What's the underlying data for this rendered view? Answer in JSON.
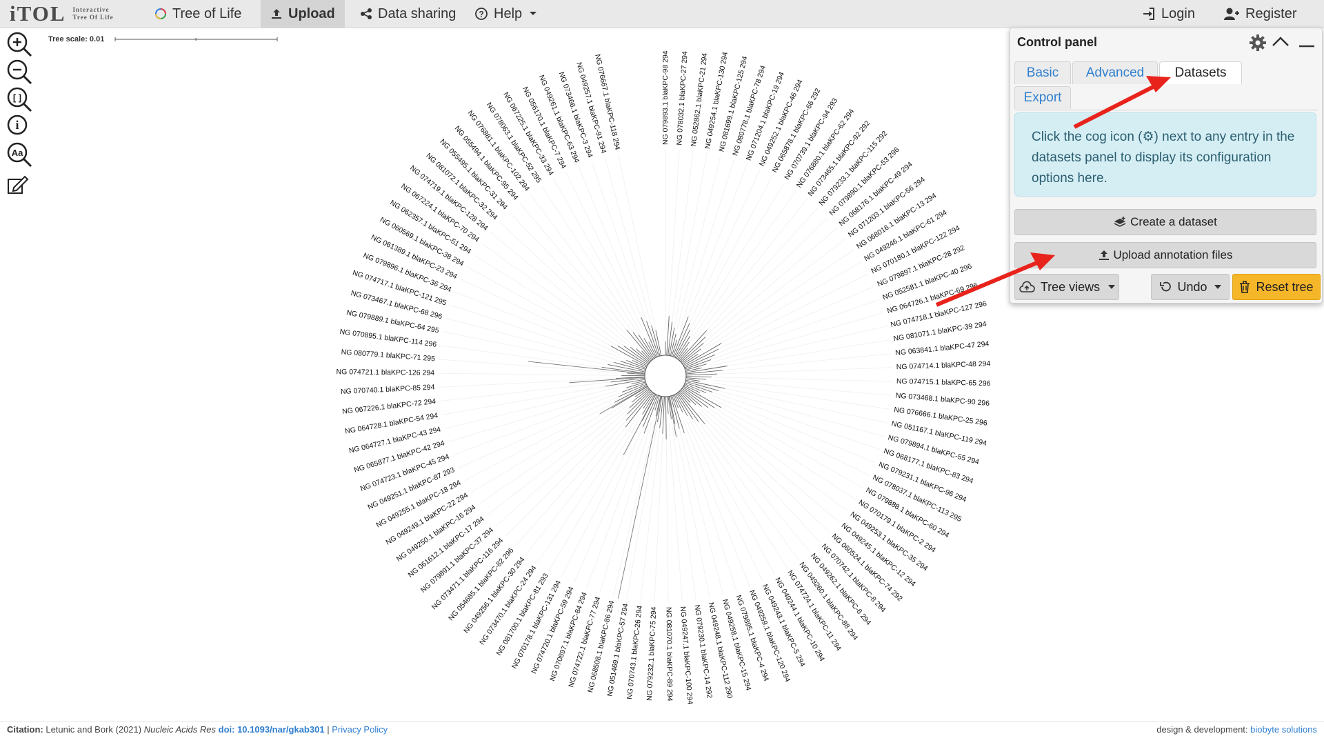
{
  "navbar": {
    "logo_main": "iTOL",
    "logo_line1": "Interactive",
    "logo_line2": "Tree Of Life",
    "items": [
      {
        "label": "Tree of Life",
        "icon": "tree-of-life-icon"
      },
      {
        "label": "Upload",
        "icon": "upload-icon"
      },
      {
        "label": "Data sharing",
        "icon": "share-icon"
      },
      {
        "label": "Help",
        "icon": "help-circle-icon"
      }
    ],
    "login": "Login",
    "register": "Register"
  },
  "toolbar": {
    "tools": [
      "zoom-in-icon",
      "zoom-out-icon",
      "zoom-fit-icon",
      "info-icon",
      "font-size-icon",
      "edit-icon"
    ]
  },
  "tree_scale": {
    "label": "Tree scale: 0.01"
  },
  "tree": {
    "leaves": [
      "NG 079893.1 blaKPC-98 294",
      "NG 078032.1 blaKPC-27 294",
      "NG 052862.1 blaKPC-21 294",
      "NG 049254.1 blaKPC-130 294",
      "NG 081699.1 blaKPC-125 294",
      "NG 080778.1 blaKPC-78 294",
      "NG 071204.1 blaKPC-19 294",
      "NG 049252.1 blaKPC-46 294",
      "NG 065878.1 blaKPC-66 292",
      "NG 070739.1 blaKPC-94 293",
      "NG 076880.1 blaKPC-62 294",
      "NG 073465.1 blaKPC-92 292",
      "NG 079233.1 blaKPC-115 292",
      "NG 079890.1 blaKPC-53 296",
      "NG 068176.1 blaKPC-49 294",
      "NG 071203.1 blaKPC-56 294",
      "NG 068016.1 blaKPC-13 294",
      "NG 049246.1 blaKPC-61 294",
      "NG 070180.1 blaKPC-122 294",
      "NG 079897.1 blaKPC-28 292",
      "NG 052581.1 blaKPC-40 296",
      "NG 064726.1 blaKPC-69 296",
      "NG 074718.1 blaKPC-127 296",
      "NG 081071.1 blaKPC-39 294",
      "NG 063841.1 blaKPC-47 294",
      "NG 074714.1 blaKPC-48 294",
      "NG 074715.1 blaKPC-65 296",
      "NG 073468.1 blaKPC-90 296",
      "NG 076666.1 blaKPC-25 296",
      "NG 051167.1 blaKPC-119 294",
      "NG 079894.1 blaKPC-55 294",
      "NG 068177.1 blaKPC-83 294",
      "NG 079231.1 blaKPC-96 294",
      "NG 078037.1 blaKPC-113 295",
      "NG 079888.1 blaKPC-60 294",
      "NG 070179.1 blaKPC-2 294",
      "NG 049253.1 blaKPC-35 294",
      "NG 049245.1 blaKPC-12 294",
      "NG 060524.1 blaKPC-74 292",
      "NG 070742.1 blaKPC-8 294",
      "NG 049262.1 blaKPC-6 294",
      "NG 049260.1 blaKPC-88 294",
      "NG 074724.1 blaKPC-11 294",
      "NG 049244.1 blaKPC-10 294",
      "NG 049243.1 blaKPC-5 294",
      "NG 049259.1 blaKPC-120 294",
      "NG 079895.1 blaKPC-4 294",
      "NG 049258.1 blaKPC-15 294",
      "NG 049248.1 blaKPC-112 290",
      "NG 079230.1 blaKPC-14 292",
      "NG 049247.1 blaKPC-100 294",
      "NG 081070.1 blaKPC-89 294",
      "NG 079232.1 blaKPC-75 294",
      "NG 070743.1 blaKPC-26 294",
      "NG 051469.1 blaKPC-57 294",
      "NG 068508.1 blaKPC-86 294",
      "NG 074722.1 blaKPC-77 294",
      "NG 070897.1 blaKPC-84 294",
      "NG 074720.1 blaKPC-59 294",
      "NG 070178.1 blaKPC-131 294",
      "NG 081700.1 blaKPC-81 293",
      "NG 073470.1 blaKPC-24 294",
      "NG 049256.1 blaKPC-30 294",
      "NG 054685.1 blaKPC-82 296",
      "NG 073471.1 blaKPC-116 294",
      "NG 079891.1 blaKPC-37 294",
      "NG 061612.1 blaKPC-17 294",
      "NG 049250.1 blaKPC-16 294",
      "NG 049249.1 blaKPC-22 294",
      "NG 049255.1 blaKPC-18 294",
      "NG 049251.1 blaKPC-87 293",
      "NG 074723.1 blaKPC-45 294",
      "NG 065877.1 blaKPC-42 294",
      "NG 064727.1 blaKPC-43 294",
      "NG 064728.1 blaKPC-54 294",
      "NG 067226.1 blaKPC-72 294",
      "NG 070740.1 blaKPC-85 294",
      "NG 074721.1 blaKPC-126 294",
      "NG 080779.1 blaKPC-71 295",
      "NG 070895.1 blaKPC-114 296",
      "NG 079889.1 blaKPC-64 295",
      "NG 073467.1 blaKPC-68 296",
      "NG 074717.1 blaKPC-121 295",
      "NG 079896.1 blaKPC-36 294",
      "NG 061389.1 blaKPC-23 294",
      "NG 060569.1 blaKPC-38 294",
      "NG 062357.1 blaKPC-51 294",
      "NG 067224.1 blaKPC-70 294",
      "NG 074719.1 blaKPC-128 294",
      "NG 081072.1 blaKPC-32 294",
      "NG 055495.1 blaKPC-31 294",
      "NG 055494.1 blaKPC-95 294",
      "NG 076881.1 blaKPC-102 294",
      "NG 078063.1 blaKPC-52 295",
      "NG 067225.1 blaKPC-33 294",
      "NG 056170.1 blaKPC-7 294",
      "NG 049261.1 blaKPC-63 294",
      "NG 073466.1 blaKPC-3 294",
      "NG 049257.1 blaKPC-91 294",
      "NG 076667.1 blaKPC-118 294"
    ]
  },
  "control_panel": {
    "title": "Control panel",
    "tabs": [
      "Basic",
      "Advanced",
      "Datasets",
      "Export"
    ],
    "active_tab": "Datasets",
    "info_text": "Click the cog icon (⚙) next to any entry in the datasets panel to display its configuration options here.",
    "create_dataset": "Create a dataset",
    "upload_annotation": "Upload annotation files",
    "tree_views": "Tree views",
    "undo": "Undo",
    "reset_tree": "Reset tree"
  },
  "footer": {
    "citation_label": "Citation:",
    "citation_authors": "Letunic and Bork (2021)",
    "citation_journal": "Nucleic Acids Res",
    "doi": "doi: 10.1093/nar/gkab301",
    "separator": "|",
    "privacy": "Privacy Policy",
    "design_label": "design & development:",
    "design_company": "biobyte solutions"
  },
  "colors": {
    "navbar_bg": "#e9e9e9",
    "link_blue": "#2f7fcf",
    "info_bg": "#d5eef4",
    "reset_yellow": "#f6b62a",
    "annotation_arrow": "#e8231c"
  }
}
